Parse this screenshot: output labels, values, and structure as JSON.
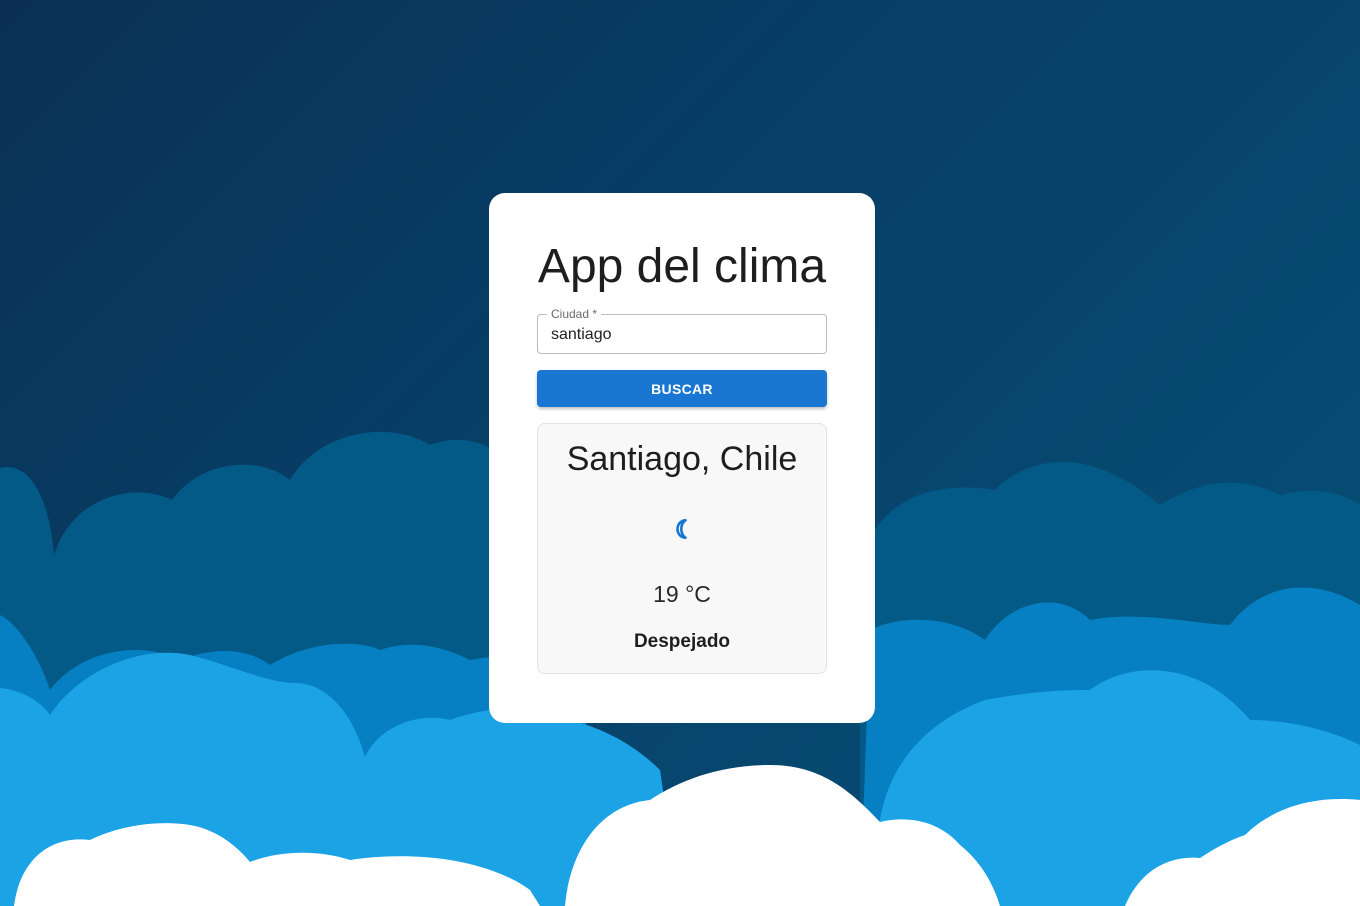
{
  "app": {
    "title": "App del clima"
  },
  "search": {
    "label": "Ciudad *",
    "value": "santiago",
    "button_label": "BUSCAR"
  },
  "weather": {
    "location": "Santiago, Chile",
    "icon": "moon-icon",
    "temperature": "19 °C",
    "description": "Despejado"
  },
  "colors": {
    "background_dark": "#0b3054",
    "accent": "#1976d2",
    "cloud_mid": "#045a86",
    "cloud_blue": "#0680c2",
    "cloud_light": "#1ba3e6",
    "cloud_white": "#ffffff"
  }
}
